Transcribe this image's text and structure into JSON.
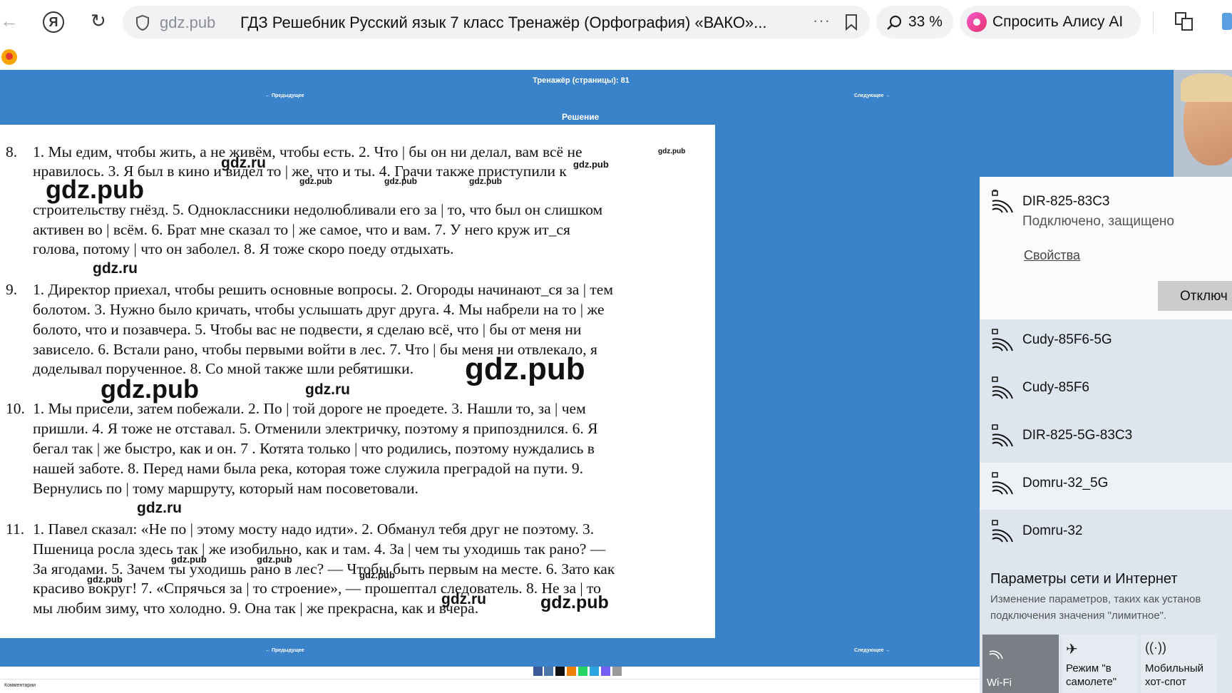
{
  "browser": {
    "domain": "gdz.pub",
    "tab_title": "ГДЗ Решебник Русский язык 7 класс Тренажёр (Орфография) «ВАКО»...",
    "zoom": "33 %",
    "alice": "Спросить Алису AI"
  },
  "page": {
    "header_title": "Тренажёр (страницы): 81",
    "prev": "← Предыдущее",
    "next": "Следующее →",
    "solution": "Решение",
    "comments": "Комментарии"
  },
  "exercise": {
    "n8": "8.",
    "n9": "9.",
    "n10": "10.",
    "n11": "11.",
    "l01": "1. Мы едим, чтобы жить, а не живём, чтобы есть. 2. Что | бы он ни делал, вам всё не",
    "l02": "нравилось. 3. Я был в кино и видел то | же, что и ты. 4. Грачи также приступили к",
    "l03": "строительству гнёзд. 5. Одноклассники недолюбливали его за | то, что был он слишком",
    "l04": "активен во | всём. 6. Брат мне сказал то | же самое, что и вам. 7. У него круж ит_ся",
    "l05": "голова, потому | что он заболел. 8. Я тоже скоро поеду отдыхать.",
    "l06": "1. Директор приехал, чтобы решить основные вопросы. 2. Огороды начинают_ся за | тем",
    "l07": "болотом. 3. Нужно было кричать, чтобы услышать друг друга. 4. Мы набрели на то | же",
    "l08": "болото, что и позавчера. 5. Чтобы вас не подвести, я сделаю всё, что | бы от меня ни",
    "l09": "зависело. 6. Встали рано, чтобы первыми войти в лес. 7. Что | бы меня ни отвлекало, я",
    "l10": "доделывал порученное. 8. Со мной также шли ребятишки.",
    "l11": "1. Мы присели, затем побежали. 2. По | той дороге не проедете. 3. Нашли то, за | чем",
    "l12": "пришли. 4. Я тоже не отставал. 5. Отменили электричку, поэтому я припозднился. 6. Я",
    "l13": "бегал так | же быстро, как и он. 7 . Котята только | что родились, поэтому нуждались в",
    "l14": "нашей заботе. 8. Перед нами была река, которая тоже служила преградой на пути. 9.",
    "l15": "Вернулись по | тому маршруту, который нам посоветовали.",
    "l16": "1. Павел сказал: «Не по | этому мосту надо идти». 2. Обманул тебя друг не поэтому. 3.",
    "l17": "Пшеница росла здесь так | же изобильно, как и там. 4. За | чем ты уходишь так рано? —",
    "l18": "За ягодами. 5. Зачем ты уходишь рано в лес? — Чтобы быть первым на месте. 6. Зато как",
    "l19": "красиво вокруг! 7. «Спрячься за | то строение», — прошептал следователь. 8. Не за | то",
    "l20": "мы любим зиму, что холодно. 9. Она так | же прекрасна, как и вчера."
  },
  "watermarks": {
    "pub": "gdz.pub",
    "ru": "gdz.ru"
  },
  "wifi": {
    "connected_name": "DIR-825-83C3",
    "connected_status": "Подключено, защищено",
    "properties": "Свойства",
    "disconnect": "Отключ",
    "networks": [
      "Cudy-85F6-5G",
      "Cudy-85F6",
      "DIR-825-5G-83C3",
      "Domru-32_5G",
      "Domru-32"
    ],
    "settings_title": "Параметры сети и Интернет",
    "settings_desc1": "Изменение параметров, таких как установ",
    "settings_desc2": "подключения значения \"лимитное\".",
    "tile_wifi": "Wi-Fi",
    "tile_airplane1": "Режим \"в",
    "tile_airplane2": "самолете\"",
    "tile_hotspot1": "Мобильный",
    "tile_hotspot2": "хот-спот"
  },
  "colors": {
    "page_blue": "#3a82c9",
    "panel_bg": "#dde5ee",
    "red_letter": "#d32f2f"
  }
}
